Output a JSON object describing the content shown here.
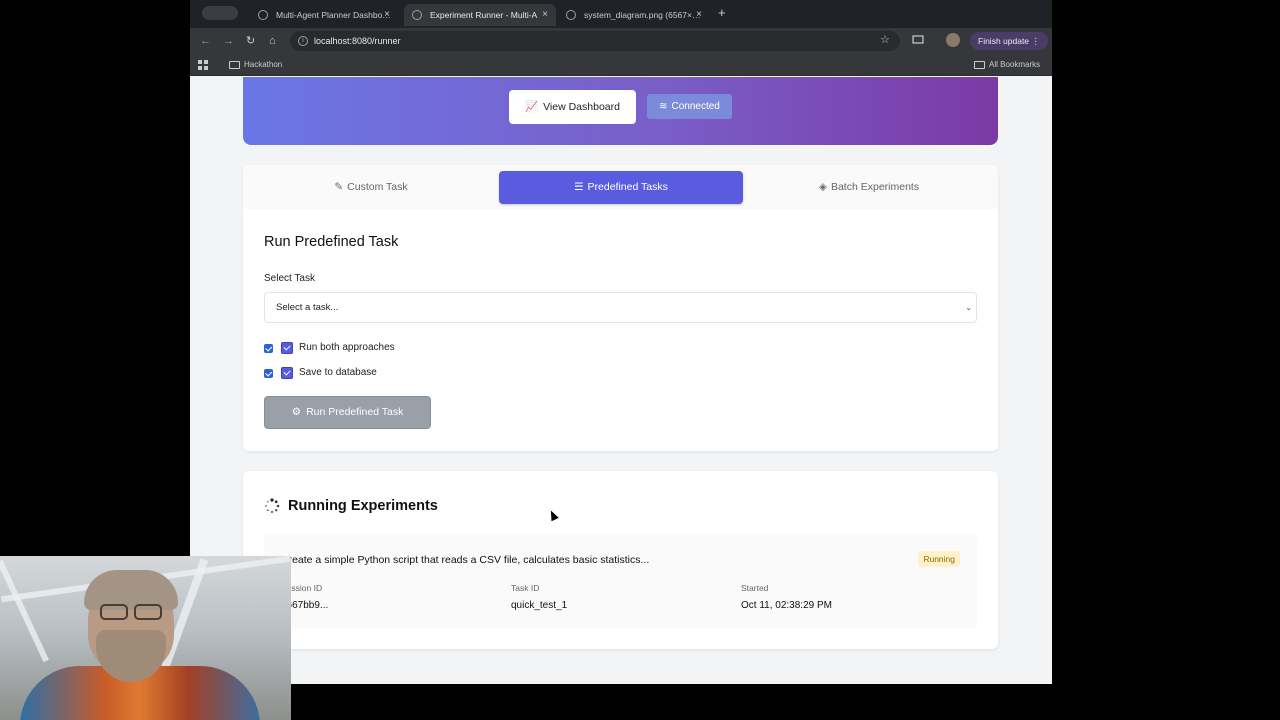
{
  "browser": {
    "tab_pill": "",
    "tabs": [
      {
        "label": "Multi-Agent Planner Dashbo…",
        "close": "×"
      },
      {
        "label": "Experiment Runner - Multi-A",
        "close": "×"
      },
      {
        "label": "system_diagram.png (6567×…",
        "close": "×"
      }
    ],
    "new_tab": "+",
    "url": "localhost:8080/runner",
    "finish_update": "Finish update",
    "bookmark_folder": "Hackathon",
    "all_bookmarks": "All Bookmarks"
  },
  "hero": {
    "view_dashboard": "View Dashboard",
    "connected": "Connected"
  },
  "tabs": [
    {
      "label": "Custom Task",
      "icon": "edit-icon"
    },
    {
      "label": "Predefined Tasks",
      "icon": "list-icon"
    },
    {
      "label": "Batch Experiments",
      "icon": "layers-icon"
    }
  ],
  "predefined": {
    "heading": "Run Predefined Task",
    "select_label": "Select Task",
    "select_value": "Select a task...",
    "option_both": "Run both approaches",
    "option_both_checked": true,
    "option_save": "Save to database",
    "option_save_checked": true,
    "run_button": "Run Predefined Task"
  },
  "running": {
    "heading": "Running Experiments",
    "experiment": {
      "title": "Create a simple Python script that reads a CSV file, calculates basic statistics...",
      "status": "Running",
      "session_label": "Session ID",
      "session_value": "6667bb9...",
      "task_label": "Task ID",
      "task_value": "quick_test_1",
      "started_label": "Started",
      "started_value": "Oct 11, 02:38:29 PM"
    }
  },
  "colors": {
    "accent": "#5a5ce0",
    "hero_start": "#6a77e6",
    "hero_end": "#7b3aa6",
    "badge_bg": "#fdf2c9"
  }
}
